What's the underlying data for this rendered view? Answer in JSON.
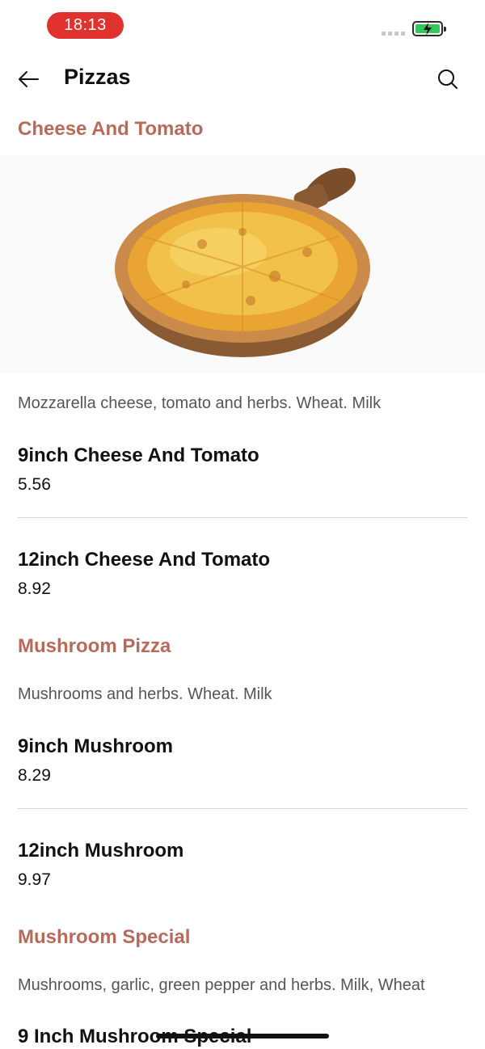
{
  "status_bar": {
    "time": "18:13"
  },
  "header": {
    "title": "Pizzas"
  },
  "sections": [
    {
      "title": "Cheese And Tomato",
      "description": "Mozzarella cheese, tomato and herbs. Wheat. Milk",
      "items": [
        {
          "name": "9inch Cheese And Tomato",
          "price": "5.56"
        },
        {
          "name": "12inch Cheese And Tomato",
          "price": "8.92"
        }
      ]
    },
    {
      "title": "Mushroom Pizza",
      "description": "Mushrooms and herbs. Wheat. Milk",
      "items": [
        {
          "name": "9inch Mushroom",
          "price": "8.29"
        },
        {
          "name": "12inch Mushroom",
          "price": "9.97"
        }
      ]
    },
    {
      "title": "Mushroom Special",
      "description": "Mushrooms, garlic, green pepper and herbs.  Milk, Wheat",
      "items": [
        {
          "name": "9 Inch Mushroom Special"
        }
      ]
    }
  ],
  "colors": {
    "accent": "#b86a5a",
    "time_pill": "#e0322e",
    "battery": "#34c759"
  }
}
